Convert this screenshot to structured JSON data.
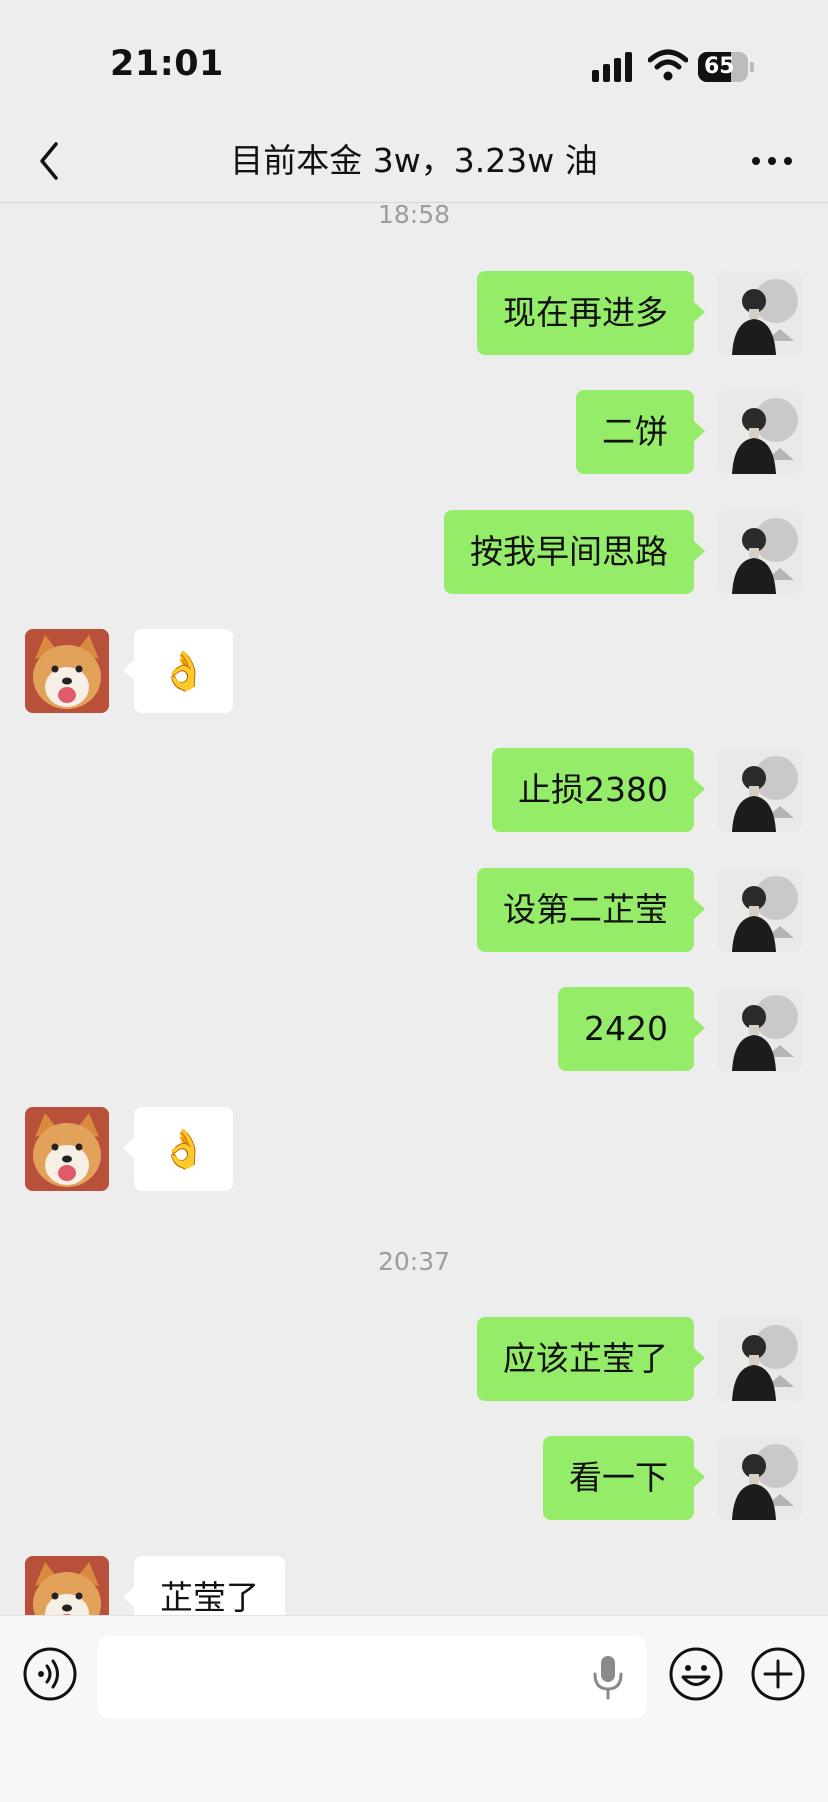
{
  "status_bar": {
    "time": "21:01",
    "battery": "65",
    "battery_level": 0.65
  },
  "header": {
    "title": "目前本金 3w，3.23w 油"
  },
  "chat": {
    "timestamps": [
      "18:58",
      "20:37"
    ],
    "messages": [
      {
        "sender": "me",
        "text": "现在再进多"
      },
      {
        "sender": "me",
        "text": "二饼"
      },
      {
        "sender": "me",
        "text": "按我早间思路"
      },
      {
        "sender": "other",
        "text": "👌"
      },
      {
        "sender": "me",
        "text": "止损2380"
      },
      {
        "sender": "me",
        "text": "设第二芷莹"
      },
      {
        "sender": "me",
        "text": "2420"
      },
      {
        "sender": "other",
        "text": "👌"
      },
      {
        "sender": "me",
        "text": "应该芷莹了"
      },
      {
        "sender": "me",
        "text": "看一下"
      },
      {
        "sender": "other",
        "text": "芷莹了"
      }
    ]
  },
  "input_bar": {
    "value": ""
  },
  "icons": {
    "back": "chevron-left-icon",
    "more": "more-icon",
    "voice": "voice-icon",
    "mic": "microphone-icon",
    "emoji": "emoji-icon",
    "add": "plus-icon"
  },
  "colors": {
    "my_bubble": "#95ec69",
    "other_bubble": "#ffffff",
    "background": "#ededed"
  }
}
